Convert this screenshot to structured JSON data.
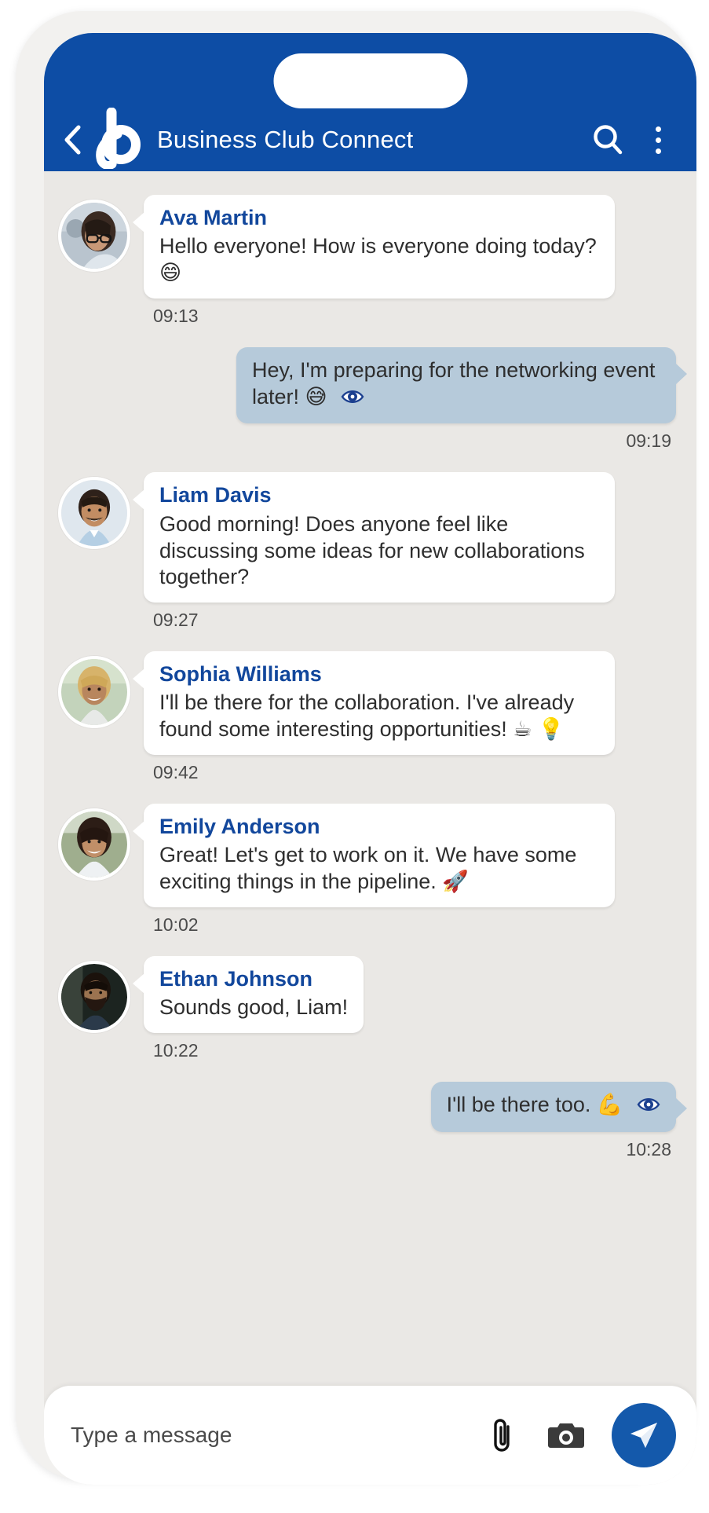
{
  "header": {
    "title": "Business Club Connect",
    "back_icon": "chevron-left-icon",
    "logo_icon": "b-logo-icon",
    "search_icon": "search-icon",
    "overflow_icon": "more-vertical-icon",
    "bar_color": "#0d4da5"
  },
  "theme": {
    "header_blue": "#0d4da5",
    "sender_name_blue": "#12479c",
    "outgoing_bubble": "#b6cada",
    "incoming_bubble": "#ffffff",
    "chat_background": "#eae8e5",
    "send_button_blue": "#1459ab"
  },
  "messages": [
    {
      "direction": "in",
      "sender": "Ava Martin",
      "text": "Hello everyone! How is everyone doing today? 😄",
      "time": "09:13",
      "avatar": "woman-with-glasses-avatar"
    },
    {
      "direction": "out",
      "sender": "",
      "text": "Hey, I'm preparing for the networking event later! 😅",
      "time": "09:19",
      "read_icon": "eye-icon"
    },
    {
      "direction": "in",
      "sender": "Liam Davis",
      "text": "Good morning! Does anyone feel like discussing some ideas for new collaborations together?",
      "time": "09:27",
      "avatar": "smiling-man-blue-shirt-avatar"
    },
    {
      "direction": "in",
      "sender": "Sophia Williams",
      "text": "I'll be there for the collaboration. I've already found some interesting opportunities! ☕ 💡",
      "time": "09:42",
      "avatar": "woman-blonde-avatar"
    },
    {
      "direction": "in",
      "sender": "Emily Anderson",
      "text": "Great! Let's get to work on it. We have some exciting things in the pipeline. 🚀",
      "time": "10:02",
      "avatar": "woman-white-blazer-avatar"
    },
    {
      "direction": "in",
      "sender": "Ethan Johnson",
      "text": "Sounds good, Liam!",
      "time": "10:22",
      "avatar": "bearded-man-dark-avatar"
    },
    {
      "direction": "out",
      "sender": "",
      "text": "I'll be there too. 💪",
      "time": "10:28",
      "read_icon": "eye-icon"
    }
  ],
  "composer": {
    "placeholder": "Type a message",
    "value": "",
    "attach_icon": "paperclip-icon",
    "camera_icon": "camera-icon",
    "send_icon": "send-paper-plane-icon"
  }
}
